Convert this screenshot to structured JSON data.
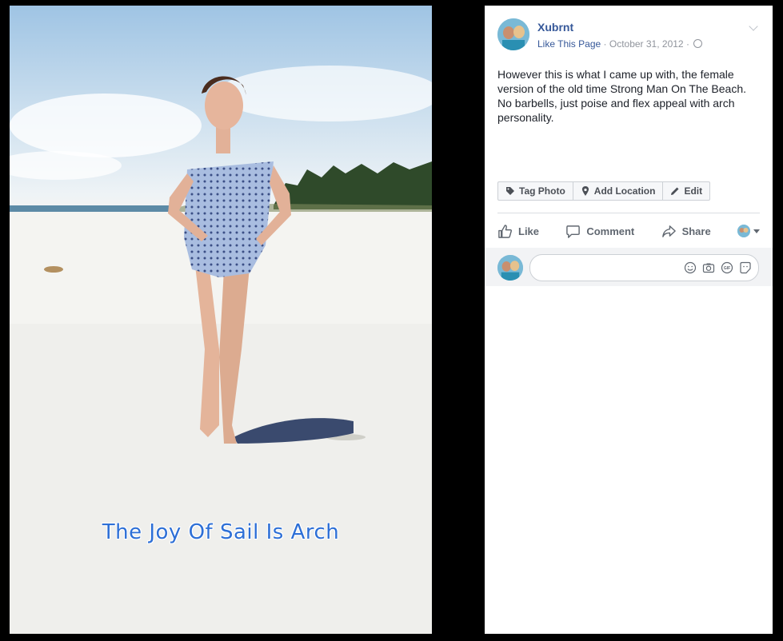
{
  "photo": {
    "caption": "The Joy Of Sail Is Arch"
  },
  "post": {
    "page_name": "Xubrnt",
    "like_page": "Like This Page",
    "separator": "·",
    "date": "October 31, 2012",
    "text": "However this is what I came up with, the female version of the old time Strong Man On The Beach. No barbells, just poise and flex appeal with arch personality."
  },
  "photo_actions": {
    "tag_photo": "Tag Photo",
    "add_location": "Add Location",
    "edit": "Edit"
  },
  "reactions": {
    "like": "Like",
    "comment": "Comment",
    "share": "Share"
  },
  "icons": {
    "tag": "tag-icon",
    "location": "location-pin-icon",
    "edit": "pencil-icon",
    "like": "thumbs-up-icon",
    "comment": "speech-bubble-icon",
    "share": "share-arrow-icon",
    "emoji": "smiley-icon",
    "camera": "camera-icon",
    "gif": "gif-icon",
    "sticker": "sticker-icon",
    "privacy": "globe-icon",
    "menu": "chevron-down-icon"
  },
  "colors": {
    "link": "#365899",
    "muted": "#90949c",
    "caption": "#2d6fd6",
    "panel_bg": "#ffffff",
    "comment_bg": "#f2f3f5"
  }
}
